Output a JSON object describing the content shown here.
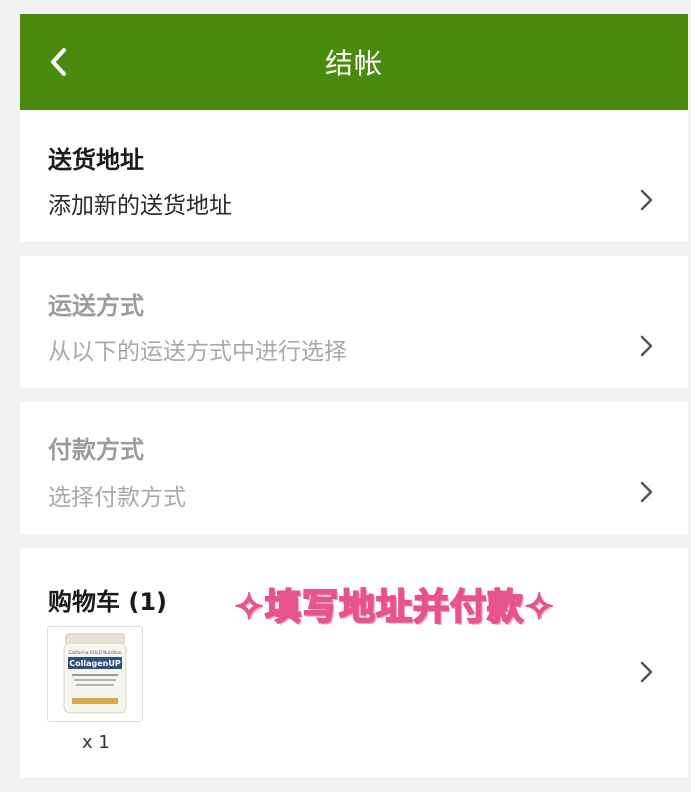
{
  "colors": {
    "header_bg": "#4a8b0e",
    "accent_pink": "#e7538c"
  },
  "header": {
    "title": "结帐",
    "back_icon": "chevron-left-icon"
  },
  "shipping_address": {
    "title": "送货地址",
    "subtitle": "添加新的送货地址"
  },
  "shipping_method": {
    "title": "运送方式",
    "subtitle": "从以下的运送方式中进行选择"
  },
  "payment_method": {
    "title": "付款方式",
    "subtitle": "选择付款方式"
  },
  "cart": {
    "title": "购物车 (1)",
    "item": {
      "brand": "California GOLD Nutrition",
      "name": "CollagenUP",
      "quantity": "x 1"
    }
  },
  "overlay_sticker": "✧填写地址并付款✧"
}
